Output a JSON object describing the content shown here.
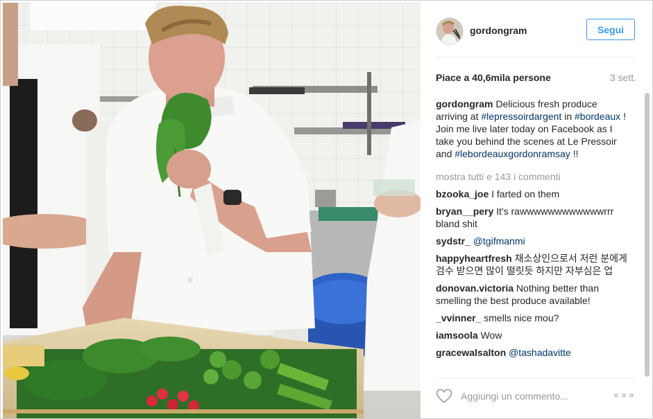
{
  "post": {
    "username": "gordongram",
    "follow_label": "Segui",
    "likes_text": "Piace a 40,6mila persone",
    "age_text": "3 sett.",
    "caption": {
      "user": "gordongram",
      "parts": [
        {
          "text": "Delicious fresh produce arriving at ",
          "tag": false
        },
        {
          "text": "#lepressoirdargent",
          "tag": true
        },
        {
          "text": " in ",
          "tag": false
        },
        {
          "text": "#bordeaux",
          "tag": true
        },
        {
          "text": " ! Join me live later today on Facebook as I take you behind the scenes at Le Pressoir and ",
          "tag": false
        },
        {
          "text": "#lebordeauxgordonramsay",
          "tag": true
        },
        {
          "text": " !!",
          "tag": false
        }
      ]
    },
    "show_all_label": "mostra tutti e 143 i commenti",
    "comments": [
      {
        "user": "bzooka_joe",
        "text": "I farted on them",
        "mention": ""
      },
      {
        "user": "bryan__pery",
        "text": "It's rawwwwwwwwwwwwrrr bland shit",
        "mention": ""
      },
      {
        "user": "sydstr_",
        "text": "",
        "mention": "@tgifmanmi"
      },
      {
        "user": "happyheartfresh",
        "text": "채소상인으로서 저런 분에게 검수 받으면 많이 떨릿듯 하지만 자부심은 업",
        "mention": ""
      },
      {
        "user": "donovan.victoria",
        "text": "Nothing better than smelling the best produce available!",
        "mention": ""
      },
      {
        "user": "_vvinner_",
        "text": "smells nice mou?",
        "mention": ""
      },
      {
        "user": "iamsoola",
        "text": "Wow",
        "mention": ""
      },
      {
        "user": "gracewalsalton",
        "text": "",
        "mention": "@tashadavitte"
      }
    ],
    "add_comment_placeholder": "Aggiungi un commento...",
    "more_options_label": "∘∘∘"
  },
  "icons": {
    "heart": "heart-icon",
    "more": "more-options-icon"
  },
  "colors": {
    "accent": "#3897f0",
    "hashtag": "#003569",
    "muted": "#999999"
  }
}
